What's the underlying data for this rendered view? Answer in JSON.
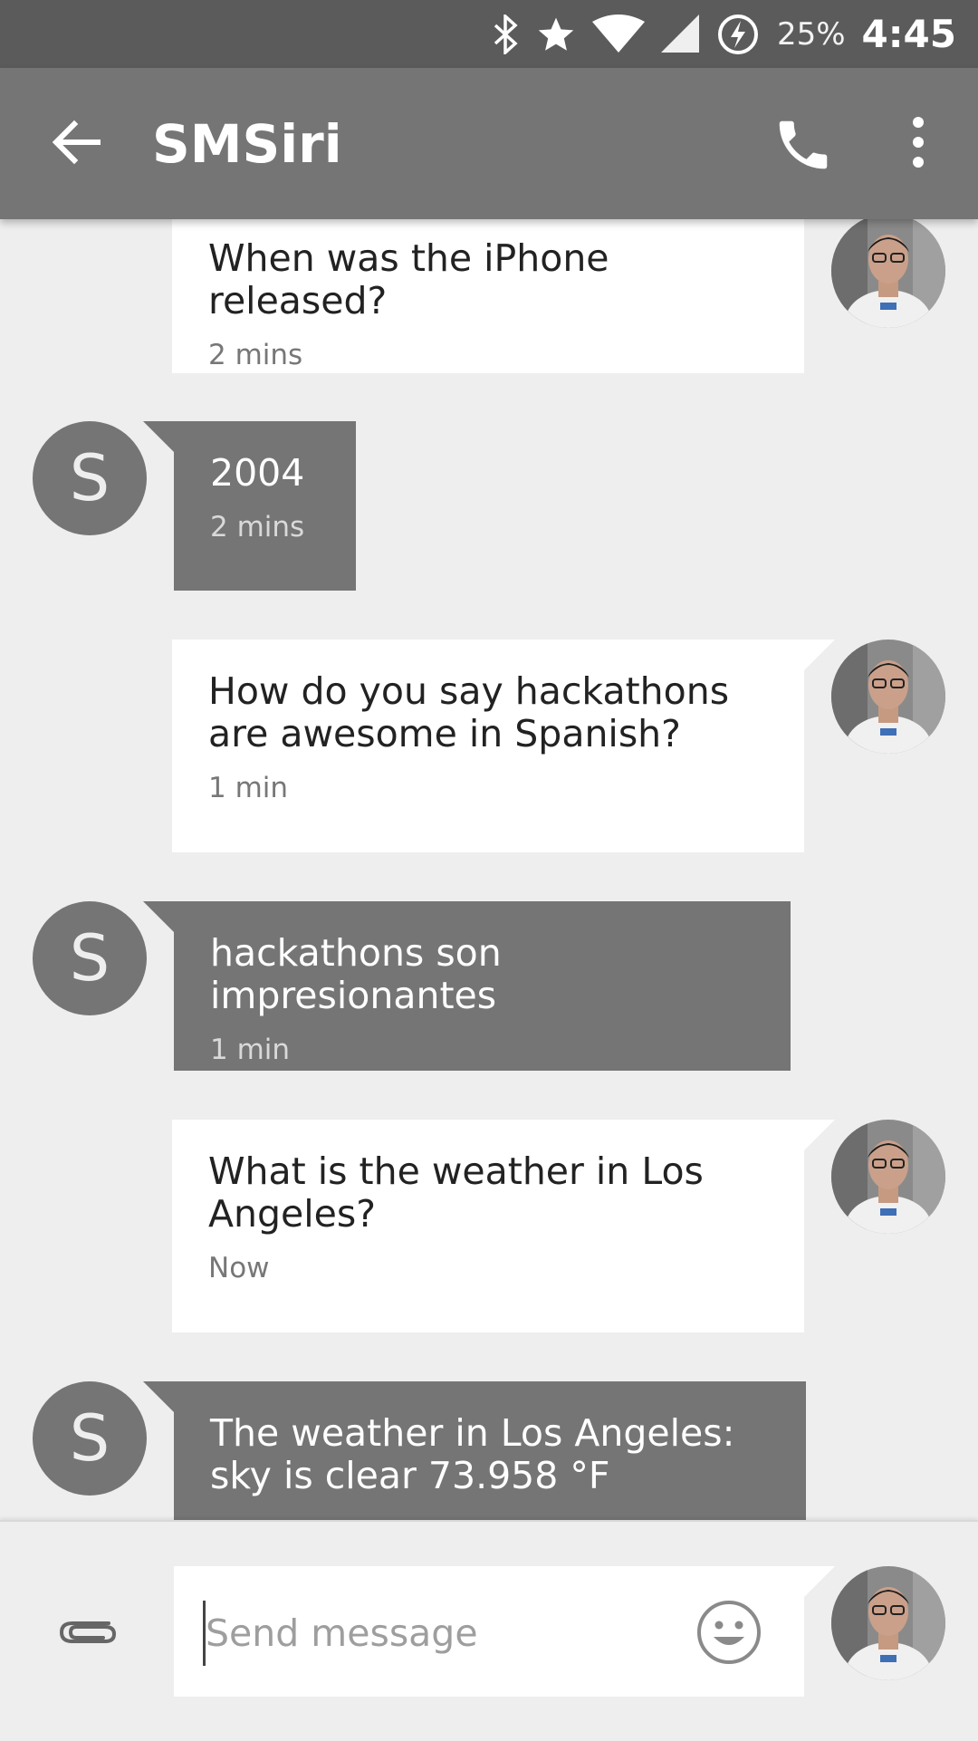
{
  "status_bar": {
    "battery_percent": "25%",
    "time": "4:45",
    "icons": [
      "bluetooth-icon",
      "star-icon",
      "wifi-icon",
      "cell-signal-icon",
      "battery-charging-icon"
    ]
  },
  "toolbar": {
    "title": "SMSiri",
    "icons": [
      "back-arrow-icon",
      "phone-icon",
      "more-vert-icon"
    ]
  },
  "contact_initial": "S",
  "messages": [
    {
      "direction": "out",
      "text": "When was the iPhone released?",
      "time": "2 mins"
    },
    {
      "direction": "in",
      "text": "2004",
      "time": "2 mins"
    },
    {
      "direction": "out",
      "text": "How do you say hackathons are awesome in Spanish?",
      "time": "1 min"
    },
    {
      "direction": "in",
      "text": "hackathons son impresionantes",
      "time": "1 min"
    },
    {
      "direction": "out",
      "text": "What is the weather in Los Angeles?",
      "time": "Now"
    },
    {
      "direction": "in",
      "text": "The weather in Los Angeles: sky is clear 73.958 °F",
      "time": ""
    }
  ],
  "composer": {
    "placeholder": "Send message",
    "value": "",
    "icons": [
      "paperclip-icon",
      "emoji-icon"
    ]
  },
  "colors": {
    "status_bar": "#5b5b5b",
    "toolbar": "#757575",
    "background": "#eeeeee",
    "incoming_bubble": "#757575",
    "outgoing_bubble": "#ffffff"
  }
}
